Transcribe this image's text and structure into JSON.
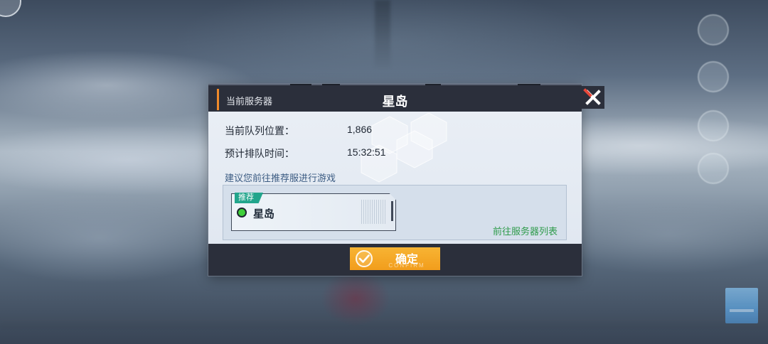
{
  "dialog": {
    "header_label": "当前服务器",
    "server_name": "星岛",
    "queue": {
      "position_label": "当前队列位置：",
      "position_value": "1,866",
      "wait_label": "预计排队时间：",
      "wait_value": "15:32:51"
    },
    "suggestion": "建议您前往推荐服进行游戏",
    "recommended": {
      "tag": "推荐",
      "name": "星岛",
      "status_icon": "online-status-icon",
      "status_color": "#3fcf3a"
    },
    "server_list_link": "前往服务器列表",
    "confirm": {
      "label": "确定",
      "sub_label": "CONFIRM",
      "icon": "check-circle-icon"
    },
    "close_icon": "close-icon"
  },
  "colors": {
    "header_bg": "#2b2f3b",
    "accent_orange": "#f5a623",
    "tag_teal": "#22a58c",
    "link_green": "#2f9b4b",
    "suggestion_blue": "#3b5b82"
  }
}
